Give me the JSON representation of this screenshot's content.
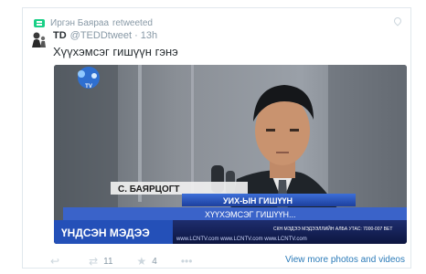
{
  "retweet": {
    "user": "Иргэн Баяраа",
    "label": "retweeted"
  },
  "tweet": {
    "display_name": "TD",
    "handle": "@TEDDtweet",
    "separator": "·",
    "time": "13h",
    "text": "Хүүхэмсэг гишүүн гэнэ"
  },
  "media": {
    "channel_logo_text": "TV",
    "lower_third": {
      "name": "С. БАЯРЦОГТ",
      "title": "УИХ-ЫН ГИШҮҮН",
      "quote": "ХҮҮХЭМСЭГ ГИШҮҮН...",
      "program": "ҮНДСЭН МЭДЭЭ",
      "ticker": "www.LCNTV.com   www.LCNTV.com   www.LCNTV.com",
      "ticker_right": "СКН МЭДЭЭ МЭДЭЭЛЛИЙН АЛБА УТАС: 7000-007 BET"
    }
  },
  "actions": {
    "retweet_count": "11",
    "like_count": "4",
    "more_label": "•••",
    "view_more": "View more photos and videos"
  },
  "colors": {
    "link": "#2b7bb9",
    "retweet_green": "#19cf86",
    "meta_gray": "#8899a6"
  }
}
